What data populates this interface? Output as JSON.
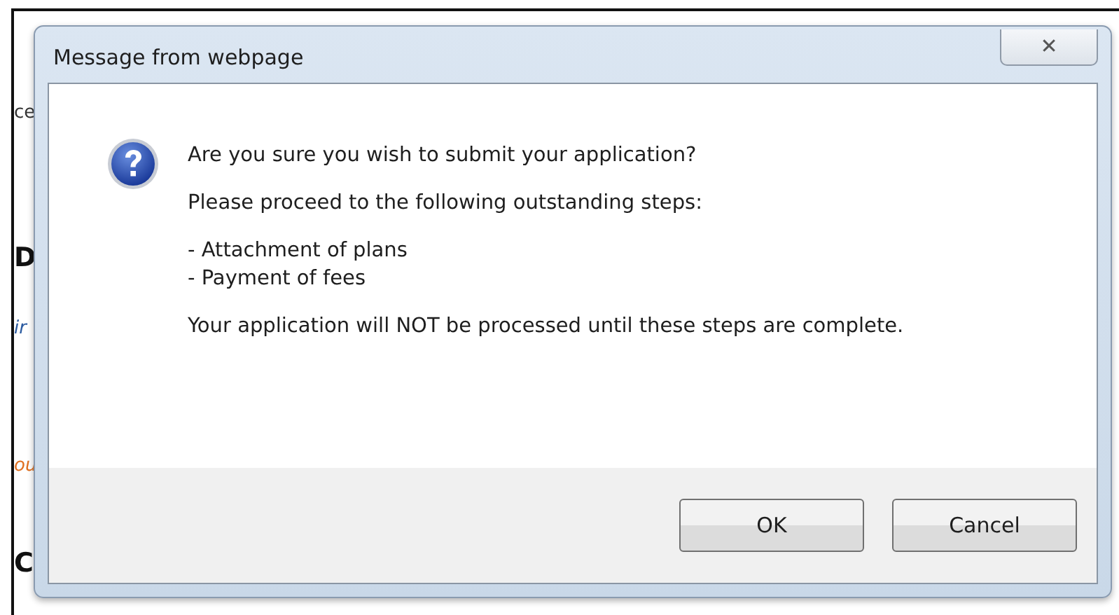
{
  "background_page": [
    {
      "text": "ce",
      "kind": "plain"
    },
    {
      "text": "D",
      "kind": "heading"
    },
    {
      "text": "ir",
      "kind": "link"
    },
    {
      "text": "ou",
      "kind": "warning"
    },
    {
      "text": "C",
      "kind": "heading"
    }
  ],
  "dialog": {
    "title": "Message from webpage",
    "close": "✕",
    "lines": [
      {
        "text": "Are you sure you wish to submit your application?",
        "kind": "para"
      },
      {
        "text": "Please proceed to the following outstanding steps:",
        "kind": "para"
      },
      {
        "text": "- Attachment of plans",
        "kind": "item"
      },
      {
        "text": "- Payment of fees",
        "kind": "item"
      },
      {
        "text": "Your application will NOT be processed until these steps are complete.",
        "kind": "para"
      }
    ],
    "buttons": [
      "OK",
      "Cancel"
    ]
  }
}
